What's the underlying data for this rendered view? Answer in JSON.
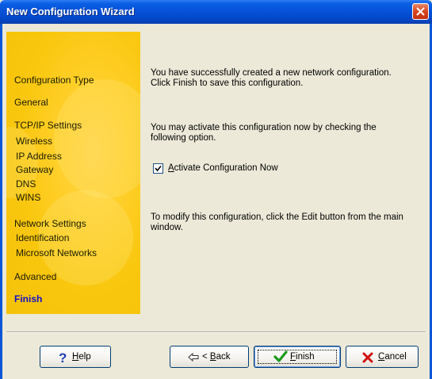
{
  "window": {
    "title": "New Configuration Wizard"
  },
  "sidebar": {
    "items": [
      {
        "label": "Configuration Type",
        "level": 0,
        "active": false
      },
      {
        "label": "General",
        "level": 0,
        "active": false
      },
      {
        "label": "TCP/IP Settings",
        "level": 0,
        "active": false
      },
      {
        "label": "Wireless",
        "level": 1,
        "active": false
      },
      {
        "label": "IP Address",
        "level": 1,
        "active": false
      },
      {
        "label": "Gateway",
        "level": 1,
        "active": false
      },
      {
        "label": "DNS",
        "level": 1,
        "active": false
      },
      {
        "label": "WINS",
        "level": 1,
        "active": false
      },
      {
        "label": "Network Settings",
        "level": 0,
        "active": false
      },
      {
        "label": "Identification",
        "level": 1,
        "active": false
      },
      {
        "label": "Microsoft Networks",
        "level": 1,
        "active": false
      },
      {
        "label": "Advanced",
        "level": 0,
        "active": false
      },
      {
        "label": "Finish",
        "level": 0,
        "active": true
      }
    ]
  },
  "main": {
    "success_line1": "You have successfully created a new network configuration.",
    "success_line2": "Click Finish to save this configuration.",
    "activate_line1": "You may activate this configuration now by checking the",
    "activate_line2": "following option.",
    "checkbox_label_first": "A",
    "checkbox_label_rest": "ctivate Configuration Now",
    "checkbox_checked": true,
    "modify_line1": "To modify this configuration, click the Edit button from the main",
    "modify_line2": "window."
  },
  "buttons": {
    "help_first": "H",
    "help_rest": "elp",
    "back_prefix": "< ",
    "back_first": "B",
    "back_rest": "ack",
    "finish_first": "F",
    "finish_rest": "inish",
    "cancel_first": "C",
    "cancel_rest": "ancel"
  },
  "icons": {
    "help": "question-mark-icon",
    "back": "back-arrow-icon",
    "finish": "green-checkmark-icon",
    "cancel": "red-x-icon",
    "close": "close-icon"
  },
  "colors": {
    "titlebar": "#0551d8",
    "sidebar": "#f9c70e",
    "active_step": "#1010c8",
    "close_button": "#d8451f"
  }
}
